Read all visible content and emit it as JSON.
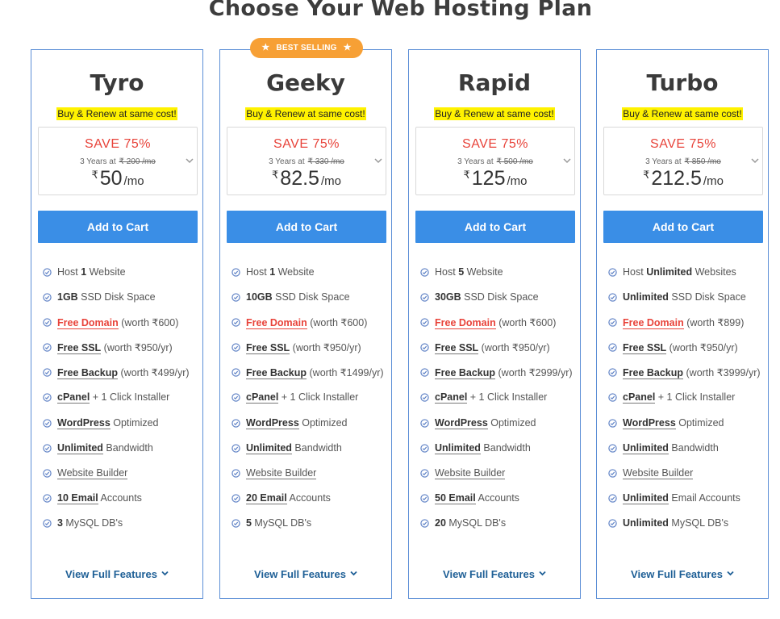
{
  "page": {
    "title": "Choose Your Web Hosting Plan"
  },
  "badge": {
    "label": "BEST SELLING"
  },
  "common": {
    "tagline": "Buy & Renew at same cost!",
    "save": "SAVE 75%",
    "term_prefix": "3 Years at",
    "currency": "₹",
    "per": "/mo",
    "cart_label": "Add to Cart",
    "view_full": "View Full Features"
  },
  "colors": {
    "accent": "#3a8ee6",
    "save_red": "#e8433a",
    "badge": "#f7a035",
    "border": "#5b8ed6",
    "highlight": "#fff200"
  },
  "plans": [
    {
      "name": "Tyro",
      "original": "₹ 200 /mo",
      "price": "50",
      "f": {
        "host": [
          "Host ",
          "1",
          " Website"
        ],
        "disk": [
          "1GB",
          " SSD Disk Space"
        ],
        "domain": [
          "Free Domain",
          " (worth ₹600)"
        ],
        "ssl": [
          "Free SSL",
          " (worth ₹950/yr)"
        ],
        "backup": [
          "Free Backup",
          " (worth ₹499/yr)"
        ],
        "cpanel": [
          "cPanel",
          " + 1 Click Installer"
        ],
        "wp": [
          "WordPress",
          " Optimized"
        ],
        "bw": [
          "Unlimited",
          " Bandwidth"
        ],
        "builder": "Website Builder",
        "email": [
          "10 Email",
          " Accounts"
        ],
        "db": [
          "3",
          " MySQL DB's"
        ]
      }
    },
    {
      "name": "Geeky",
      "original": "₹ 330 /mo",
      "price": "82.5",
      "f": {
        "host": [
          "Host ",
          "1",
          " Website"
        ],
        "disk": [
          "10GB",
          " SSD Disk Space"
        ],
        "domain": [
          "Free Domain",
          " (worth ₹600)"
        ],
        "ssl": [
          "Free SSL",
          " (worth ₹950/yr)"
        ],
        "backup": [
          "Free Backup",
          " (worth ₹1499/yr)"
        ],
        "cpanel": [
          "cPanel",
          " + 1 Click Installer"
        ],
        "wp": [
          "WordPress",
          " Optimized"
        ],
        "bw": [
          "Unlimited",
          " Bandwidth"
        ],
        "builder": "Website Builder",
        "email": [
          "20 Email",
          " Accounts"
        ],
        "db": [
          "5",
          " MySQL DB's"
        ]
      }
    },
    {
      "name": "Rapid",
      "original": "₹ 500 /mo",
      "price": "125",
      "f": {
        "host": [
          "Host ",
          "5",
          " Website"
        ],
        "disk": [
          "30GB",
          " SSD Disk Space"
        ],
        "domain": [
          "Free Domain",
          " (worth ₹600)"
        ],
        "ssl": [
          "Free SSL",
          " (worth ₹950/yr)"
        ],
        "backup": [
          "Free Backup",
          " (worth ₹2999/yr)"
        ],
        "cpanel": [
          "cPanel",
          " + 1 Click Installer"
        ],
        "wp": [
          "WordPress",
          " Optimized"
        ],
        "bw": [
          "Unlimited",
          " Bandwidth"
        ],
        "builder": "Website Builder",
        "email": [
          "50 Email",
          " Accounts"
        ],
        "db": [
          "20",
          " MySQL DB's"
        ]
      }
    },
    {
      "name": "Turbo",
      "original": "₹ 850 /mo",
      "price": "212.5",
      "f": {
        "host": [
          "Host ",
          "Unlimited",
          " Websites"
        ],
        "disk": [
          "Unlimited",
          " SSD Disk Space"
        ],
        "domain": [
          "Free Domain",
          " (worth ₹899)"
        ],
        "ssl": [
          "Free SSL",
          " (worth ₹950/yr)"
        ],
        "backup": [
          "Free Backup",
          " (worth ₹3999/yr)"
        ],
        "cpanel": [
          "cPanel",
          " + 1 Click Installer"
        ],
        "wp": [
          "WordPress",
          " Optimized"
        ],
        "bw": [
          "Unlimited",
          " Bandwidth"
        ],
        "builder": "Website Builder",
        "email": [
          "Unlimited",
          " Email Accounts"
        ],
        "db": [
          "Unlimited",
          " MySQL DB's"
        ]
      }
    }
  ]
}
